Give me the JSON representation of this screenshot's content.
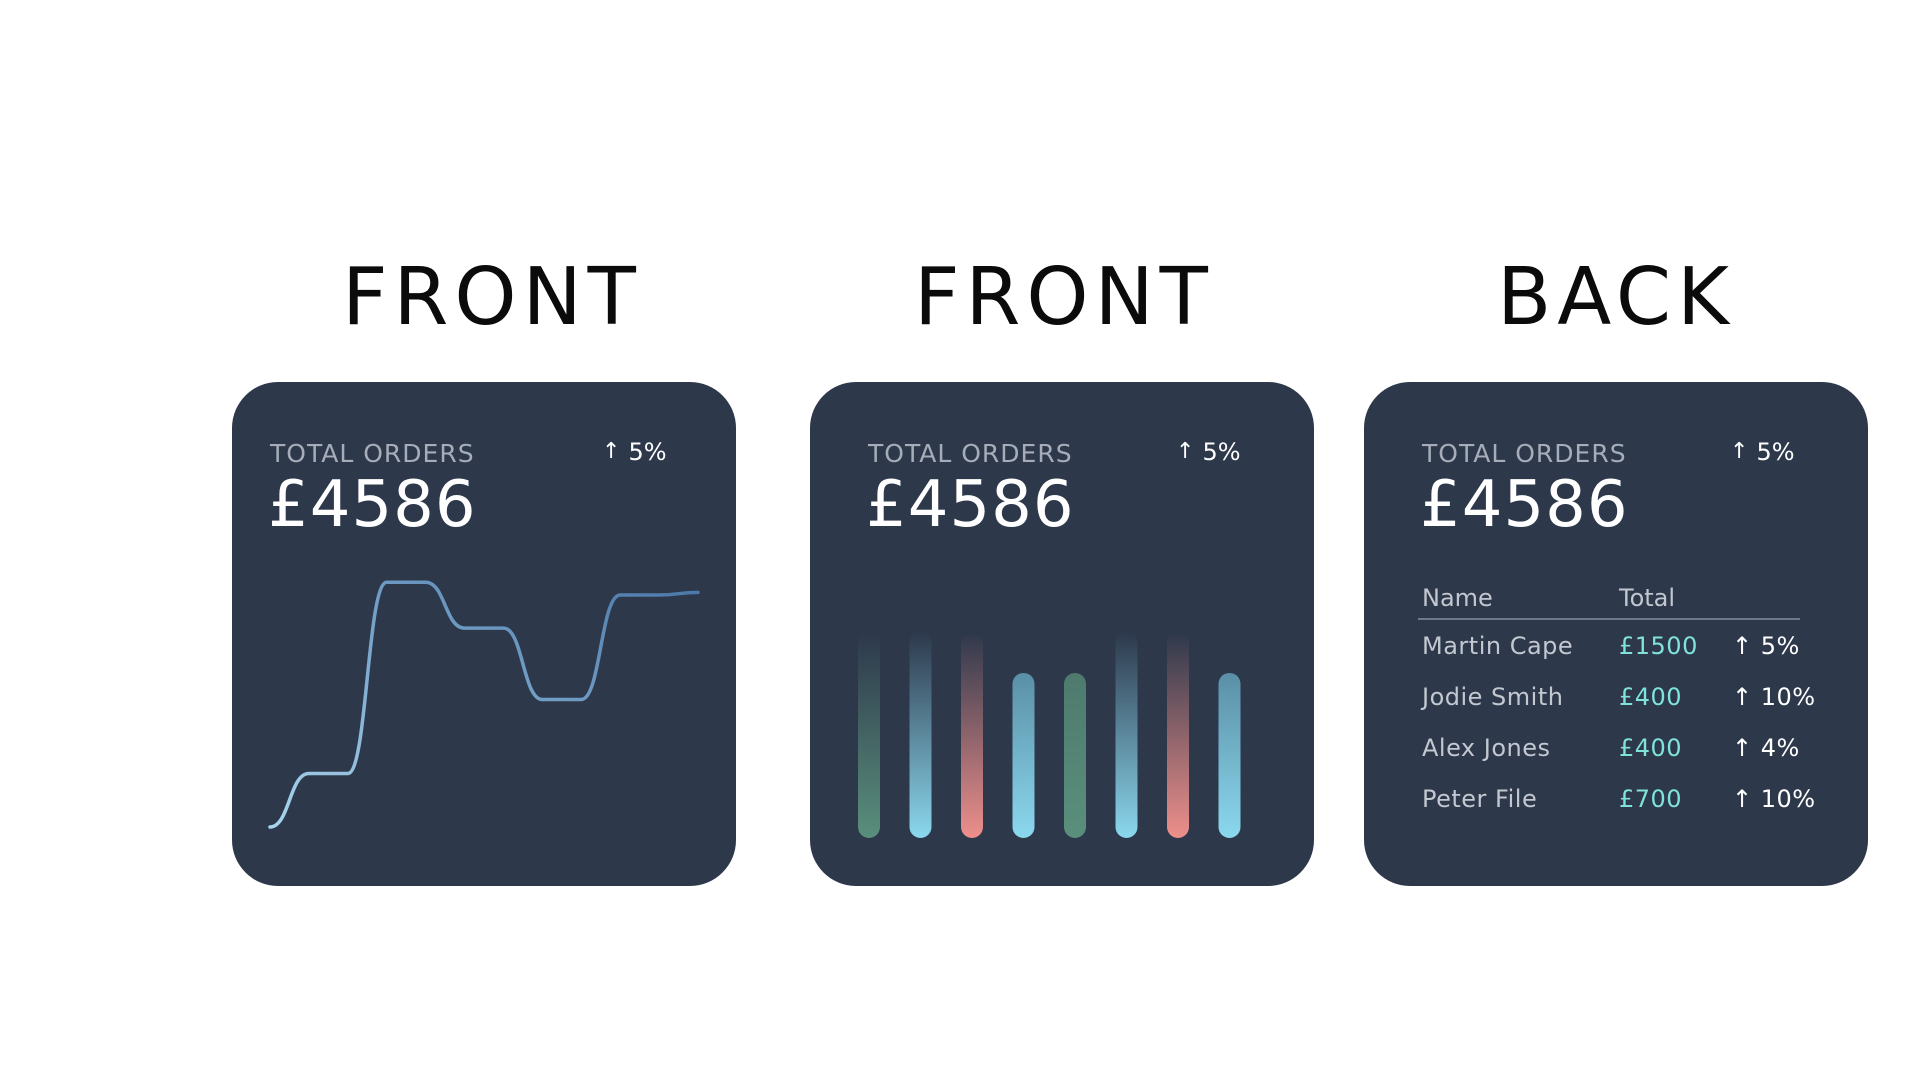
{
  "titles": [
    "FRONT",
    "FRONT",
    "BACK"
  ],
  "cards": [
    {
      "label": "TOTAL ORDERS",
      "change": "5%",
      "value": "£4586"
    },
    {
      "label": "TOTAL ORDERS",
      "change": "5%",
      "value": "£4586"
    },
    {
      "label": "TOTAL ORDERS",
      "change": "5%",
      "value": "£4586"
    }
  ],
  "icons": {
    "change": "arrow-up-icon"
  },
  "colors": {
    "card_bg": "#2d384b",
    "line_start": "#a8d4ee",
    "line_end": "#4a77a8",
    "bar_green": "#5a8f7c",
    "bar_cyan": "#8bd8ee",
    "bar_salmon": "#ee8f8b",
    "table_total": "#7fe3dc"
  },
  "table": {
    "headers": {
      "name": "Name",
      "total": "Total"
    },
    "rows": [
      {
        "name": "Martin Cape",
        "total": "£1500",
        "change": "5%"
      },
      {
        "name": "Jodie Smith",
        "total": "£400",
        "change": "10%"
      },
      {
        "name": "Alex Jones",
        "total": "£400",
        "change": "4%"
      },
      {
        "name": "Peter File",
        "total": "£700",
        "change": "10%"
      }
    ]
  },
  "chart_data": [
    {
      "type": "line",
      "title": "",
      "xlabel": "",
      "ylabel": "",
      "x": [
        0,
        1,
        2,
        3,
        4,
        5,
        6,
        7,
        8,
        9,
        10,
        11
      ],
      "values": [
        0,
        2.1,
        2.1,
        9.6,
        9.6,
        7.8,
        7.8,
        5.0,
        5.0,
        9.1,
        9.1,
        9.2
      ],
      "ylim": [
        0,
        10
      ]
    },
    {
      "type": "bar",
      "title": "",
      "categories": [
        "1",
        "2",
        "3",
        "4",
        "5",
        "6",
        "7",
        "8"
      ],
      "values": [
        10,
        10,
        10,
        7.9,
        7.9,
        10,
        10,
        7.9
      ],
      "bar_colors": [
        "green",
        "cyan",
        "salmon",
        "cyan",
        "green",
        "cyan",
        "salmon",
        "cyan"
      ],
      "ylim": [
        0,
        10
      ]
    }
  ]
}
